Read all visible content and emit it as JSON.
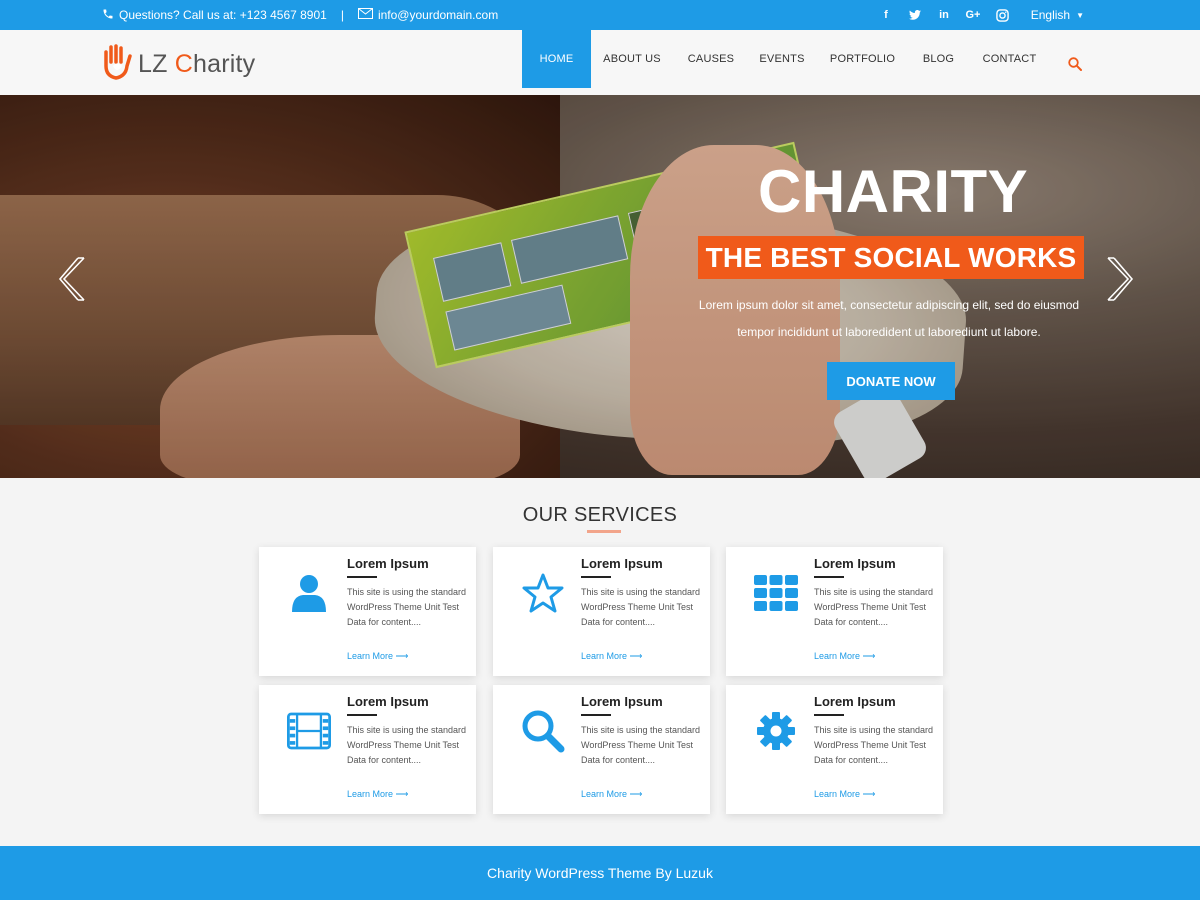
{
  "topbar": {
    "phone_text": "Questions? Call us at: +123 4567 8901",
    "separator": "|",
    "email": "info@yourdomain.com",
    "social": [
      "facebook-icon",
      "twitter-icon",
      "linkedin-icon",
      "google-plus-icon",
      "instagram-icon"
    ],
    "language": "English"
  },
  "header": {
    "logo_prefix": "LZ ",
    "logo_c": "C",
    "logo_rest": "harity",
    "nav": [
      "HOME",
      "ABOUT US",
      "CAUSES",
      "EVENTS",
      "PORTFOLIO",
      "BLOG",
      "CONTACT"
    ],
    "active": "HOME"
  },
  "hero": {
    "title": "CHARITY",
    "subtitle": "THE BEST SOCIAL WORKS",
    "text": "Lorem ipsum dolor sit amet, consectetur adipiscing elit, sed do eiusmod tempor incididunt ut laboredident ut laborediunt ut labore.",
    "button": "DONATE NOW"
  },
  "services": {
    "title": "OUR SERVICES",
    "cards": [
      {
        "icon": "user-icon",
        "title": "Lorem Ipsum",
        "text": "This site is using the standard WordPress Theme Unit Test Data for content....",
        "link": "Learn More ⟶"
      },
      {
        "icon": "star-icon",
        "title": "Lorem Ipsum",
        "text": "This site is using the standard WordPress Theme Unit Test Data for content....",
        "link": "Learn More ⟶"
      },
      {
        "icon": "grid-icon",
        "title": "Lorem Ipsum",
        "text": "This site is using the standard WordPress Theme Unit Test Data for content....",
        "link": "Learn More ⟶"
      },
      {
        "icon": "film-icon",
        "title": "Lorem Ipsum",
        "text": "This site is using the standard WordPress Theme Unit Test Data for content....",
        "link": "Learn More ⟶"
      },
      {
        "icon": "search-icon",
        "title": "Lorem Ipsum",
        "text": "This site is using the standard WordPress Theme Unit Test Data for content....",
        "link": "Learn More ⟶"
      },
      {
        "icon": "gear-icon",
        "title": "Lorem Ipsum",
        "text": "This site is using the standard WordPress Theme Unit Test Data for content....",
        "link": "Learn More ⟶"
      }
    ]
  },
  "footer": {
    "text": "Charity WordPress Theme By Luzuk"
  },
  "colors": {
    "primary": "#1e9be6",
    "accent": "#f05a1a"
  }
}
